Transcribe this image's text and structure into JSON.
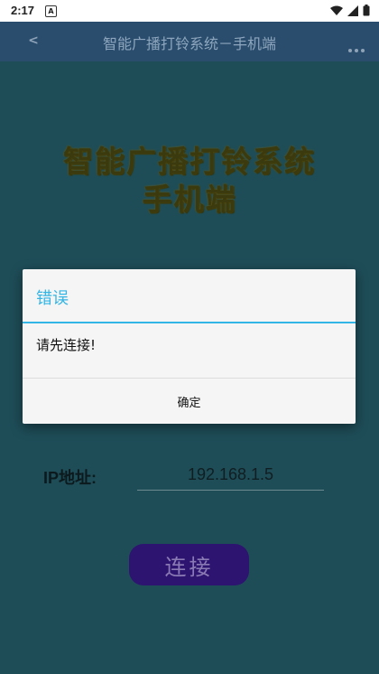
{
  "status_bar": {
    "time": "2:17",
    "notification_glyph": "A",
    "icons": [
      "wifi-icon",
      "signal-icon",
      "battery-icon"
    ]
  },
  "app_bar": {
    "back_label": "<",
    "title": "智能广播打铃系统－手机端",
    "overflow_label": "..."
  },
  "hero": {
    "line1": "智能广播打铃系统",
    "line2": "手机端"
  },
  "form": {
    "ip_label": "IP地址:",
    "ip_value": "192.168.1.5",
    "connect_label": "连接"
  },
  "dialog": {
    "title": "错误",
    "message": "请先连接!",
    "ok_label": "确定"
  },
  "colors": {
    "background": "#1e4d58",
    "app_bar": "#2a4d6e",
    "dialog_accent": "#33b5e5",
    "connect_button": "#2d1470",
    "hero_text": "#3a3a0e"
  }
}
